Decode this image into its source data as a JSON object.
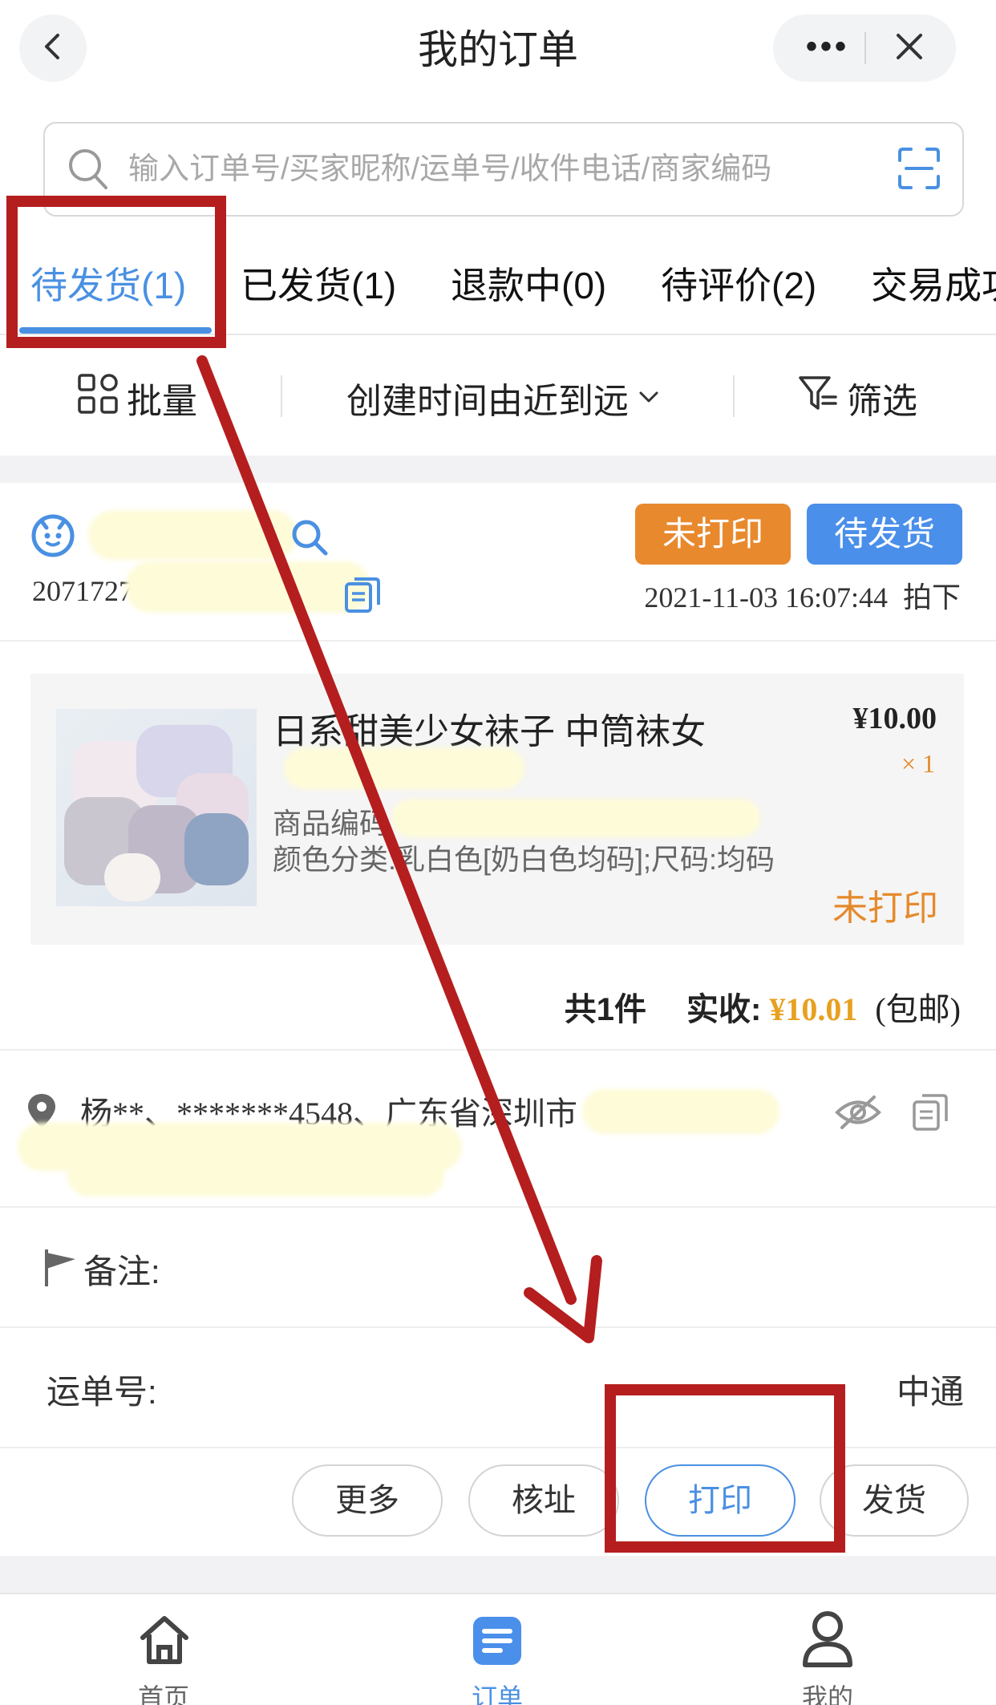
{
  "header": {
    "title": "我的订单",
    "more_glyph": "•••"
  },
  "search": {
    "placeholder": "输入订单号/买家昵称/运单号/收件电话/商家编码"
  },
  "tabs": [
    {
      "label": "待发货(1)",
      "active": true
    },
    {
      "label": "已发货(1)"
    },
    {
      "label": "退款中(0)"
    },
    {
      "label": "待评价(2)"
    },
    {
      "label": "交易成功"
    }
  ],
  "toolbar": {
    "batch_label": "批量",
    "sort_label": "创建时间由近到远",
    "filter_label": "筛选"
  },
  "order": {
    "print_badge": "未打印",
    "status_badge": "待发货",
    "order_number": "20717270562179402",
    "created_time": "2021-11-03 16:07:44",
    "created_suffix": "拍下",
    "product": {
      "title": "日系甜美少女袜子 中筒袜女",
      "price": "¥10.00",
      "quantity": "× 1",
      "code_label": "商品编码",
      "spec": "颜色分类:乳白色[奶白色均码];尺码:均码",
      "print_status": "未打印"
    },
    "summary": {
      "count_label": "共1件",
      "received_label": "实收:",
      "received_value": "¥10.01",
      "postage": "(包邮)"
    },
    "address": "杨**、*******4548、广东省深圳市",
    "remark_label": "备注:",
    "waybill_label": "运单号:",
    "carrier": "中通",
    "actions": {
      "more": "更多",
      "verify": "核址",
      "print": "打印",
      "ship": "发货"
    }
  },
  "nav": [
    {
      "label": "首页",
      "icon": "home-icon"
    },
    {
      "label": "订单",
      "icon": "orders-icon",
      "active": true
    },
    {
      "label": "我的",
      "icon": "profile-icon"
    }
  ],
  "colors": {
    "accent": "#4a90e2",
    "orange": "#e8892e",
    "annotation_red": "#b51e1e"
  }
}
